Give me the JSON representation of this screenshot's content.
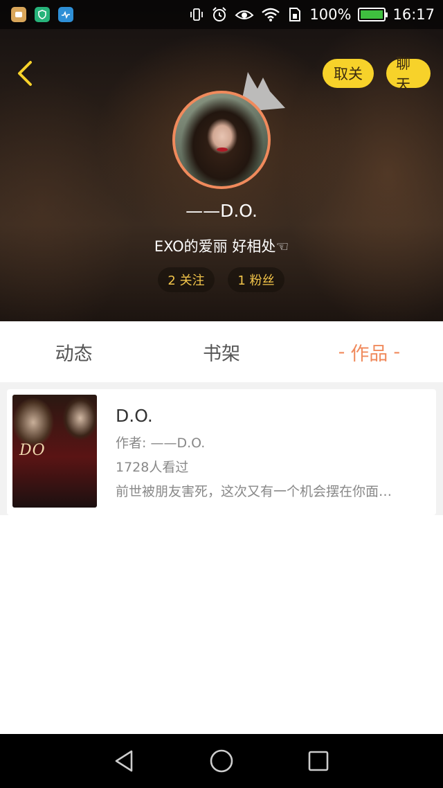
{
  "status_bar": {
    "battery_percent": "100%",
    "time": "16:17",
    "icons": [
      "app-icon-1",
      "app-icon-2",
      "app-icon-3",
      "vibrate-icon",
      "alarm-icon",
      "eye-icon",
      "wifi-icon",
      "sim-icon",
      "battery-icon"
    ]
  },
  "header": {
    "back_icon": "chevron-left-icon",
    "unfollow_label": "取关",
    "chat_label": "聊天",
    "username": "——D.O.",
    "bio": "EXO的爱丽 好相处☜",
    "following": "2 关注",
    "fans": "1 粉丝",
    "colors": {
      "accent_yellow": "#f7d22a",
      "stat_text": "#f3c54a",
      "avatar_ring": "#f08a5c"
    }
  },
  "tabs": [
    {
      "label": "动态",
      "active": false
    },
    {
      "label": "书架",
      "active": false
    },
    {
      "label": "作品",
      "active": true,
      "dash": "-"
    }
  ],
  "works": [
    {
      "cover_text": "DO",
      "title": "D.O.",
      "author": "作者: ——D.O.",
      "views": "1728人看过",
      "summary": "前世被朋友害死，这次又有一个机会摆在你面…"
    }
  ],
  "nav": {
    "back": "back-triangle-icon",
    "home": "home-circle-icon",
    "recents": "recents-square-icon"
  }
}
